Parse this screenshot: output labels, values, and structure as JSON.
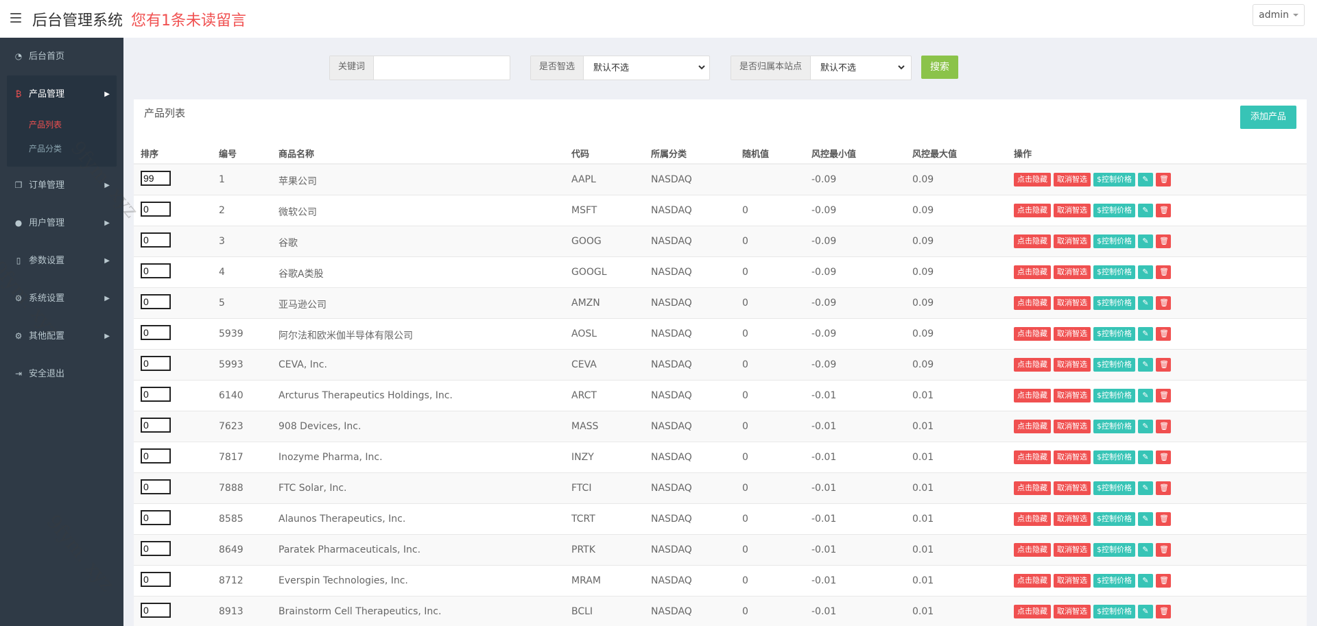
{
  "header": {
    "app_title": "后台管理系统",
    "unread_message": "您有1条未读留言",
    "user": "admin"
  },
  "sidebar": {
    "items": [
      {
        "label": "后台首页",
        "icon": "dashboard-icon"
      },
      {
        "label": "产品管理",
        "icon": "bitcoin-icon",
        "expanded": true,
        "children": [
          {
            "label": "产品列表",
            "active": true
          },
          {
            "label": "产品分类",
            "active": false
          }
        ]
      },
      {
        "label": "订单管理",
        "icon": "copy-icon"
      },
      {
        "label": "用户管理",
        "icon": "user-icon"
      },
      {
        "label": "参数设置",
        "icon": "file-icon"
      },
      {
        "label": "系统设置",
        "icon": "cogs-icon"
      },
      {
        "label": "其他配置",
        "icon": "gear-icon"
      },
      {
        "label": "安全退出",
        "icon": "sign-out-icon"
      }
    ]
  },
  "search": {
    "keyword_label": "关键词",
    "keyword_value": "",
    "smart_label": "是否智选",
    "smart_value": "默认不选",
    "site_label": "是否归属本站点",
    "site_value": "默认不选",
    "button": "搜索"
  },
  "panel": {
    "title": "产品列表",
    "add_button": "添加产品"
  },
  "table": {
    "columns": [
      "排序",
      "编号",
      "商品名称",
      "代码",
      "所属分类",
      "随机值",
      "风控最小值",
      "风控最大值",
      "操作"
    ],
    "actions": [
      "点击隐藏",
      "取消智选",
      "$控制价格"
    ],
    "rows": [
      {
        "sort": "99",
        "id": "1",
        "name": "苹果公司",
        "code": "AAPL",
        "category": "NASDAQ",
        "random": "",
        "min": "-0.09",
        "max": "0.09"
      },
      {
        "sort": "0",
        "id": "2",
        "name": "微软公司",
        "code": "MSFT",
        "category": "NASDAQ",
        "random": "0",
        "min": "-0.09",
        "max": "0.09"
      },
      {
        "sort": "0",
        "id": "3",
        "name": "谷歌",
        "code": "GOOG",
        "category": "NASDAQ",
        "random": "0",
        "min": "-0.09",
        "max": "0.09"
      },
      {
        "sort": "0",
        "id": "4",
        "name": "谷歌A类股",
        "code": "GOOGL",
        "category": "NASDAQ",
        "random": "0",
        "min": "-0.09",
        "max": "0.09"
      },
      {
        "sort": "0",
        "id": "5",
        "name": "亚马逊公司",
        "code": "AMZN",
        "category": "NASDAQ",
        "random": "0",
        "min": "-0.09",
        "max": "0.09"
      },
      {
        "sort": "0",
        "id": "5939",
        "name": "阿尔法和欧米伽半导体有限公司",
        "code": "AOSL",
        "category": "NASDAQ",
        "random": "0",
        "min": "-0.09",
        "max": "0.09"
      },
      {
        "sort": "0",
        "id": "5993",
        "name": "CEVA, Inc.",
        "code": "CEVA",
        "category": "NASDAQ",
        "random": "0",
        "min": "-0.09",
        "max": "0.09"
      },
      {
        "sort": "0",
        "id": "6140",
        "name": "Arcturus Therapeutics Holdings, Inc.",
        "code": "ARCT",
        "category": "NASDAQ",
        "random": "0",
        "min": "-0.01",
        "max": "0.01"
      },
      {
        "sort": "0",
        "id": "7623",
        "name": "908 Devices, Inc.",
        "code": "MASS",
        "category": "NASDAQ",
        "random": "0",
        "min": "-0.01",
        "max": "0.01"
      },
      {
        "sort": "0",
        "id": "7817",
        "name": "Inozyme Pharma, Inc.",
        "code": "INZY",
        "category": "NASDAQ",
        "random": "0",
        "min": "-0.01",
        "max": "0.01"
      },
      {
        "sort": "0",
        "id": "7888",
        "name": "FTC Solar, Inc.",
        "code": "FTCI",
        "category": "NASDAQ",
        "random": "0",
        "min": "-0.01",
        "max": "0.01"
      },
      {
        "sort": "0",
        "id": "8585",
        "name": "Alaunos Therapeutics, Inc.",
        "code": "TCRT",
        "category": "NASDAQ",
        "random": "0",
        "min": "-0.01",
        "max": "0.01"
      },
      {
        "sort": "0",
        "id": "8649",
        "name": "Paratek Pharmaceuticals, Inc.",
        "code": "PRTK",
        "category": "NASDAQ",
        "random": "0",
        "min": "-0.01",
        "max": "0.01"
      },
      {
        "sort": "0",
        "id": "8712",
        "name": "Everspin Technologies, Inc.",
        "code": "MRAM",
        "category": "NASDAQ",
        "random": "0",
        "min": "-0.01",
        "max": "0.01"
      },
      {
        "sort": "0",
        "id": "8913",
        "name": "Brainstorm Cell Therapeutics, Inc.",
        "code": "BCLI",
        "category": "NASDAQ",
        "random": "0",
        "min": "-0.01",
        "max": "0.01"
      }
    ]
  },
  "watermark": "9fym. xyz"
}
